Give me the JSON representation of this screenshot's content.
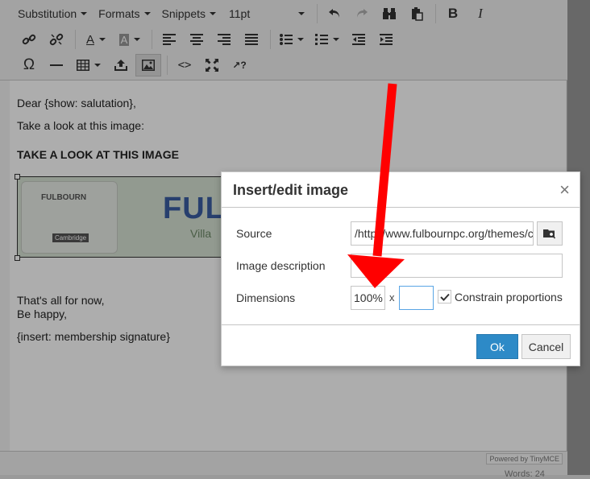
{
  "toolbar": {
    "row1": {
      "substitution": "Substitution",
      "formats": "Formats",
      "snippets": "Snippets",
      "font_size": "11pt"
    }
  },
  "content": {
    "line1": "Dear {show: salutation},",
    "line2": "Take a look at this image:",
    "heading": "TAKE A LOOK AT THIS IMAGE",
    "image": {
      "logo_top": "FULBOURN",
      "logo_bottom": "Cambridge",
      "title": "FUL",
      "subtitle": "Villa"
    },
    "line3": "That's all for now,",
    "line4": "Be happy,",
    "line5": "{insert: membership signature}"
  },
  "statusbar": {
    "powered_by": "Powered by TinyMCE",
    "word_count": "Words: 24"
  },
  "dialog": {
    "title": "Insert/edit image",
    "close_glyph": "×",
    "source": {
      "label": "Source",
      "value": "/https/www.fulbournpc.org/themes/c"
    },
    "description": {
      "label": "Image description",
      "value": ""
    },
    "dimensions": {
      "label": "Dimensions",
      "width": "100%",
      "separator": "x",
      "height": ""
    },
    "constrain": {
      "label": "Constrain proportions",
      "checked": true
    },
    "ok_label": "Ok",
    "cancel_label": "Cancel"
  },
  "colors": {
    "accent": "#2d8ac7",
    "arrow": "#ff0000"
  }
}
